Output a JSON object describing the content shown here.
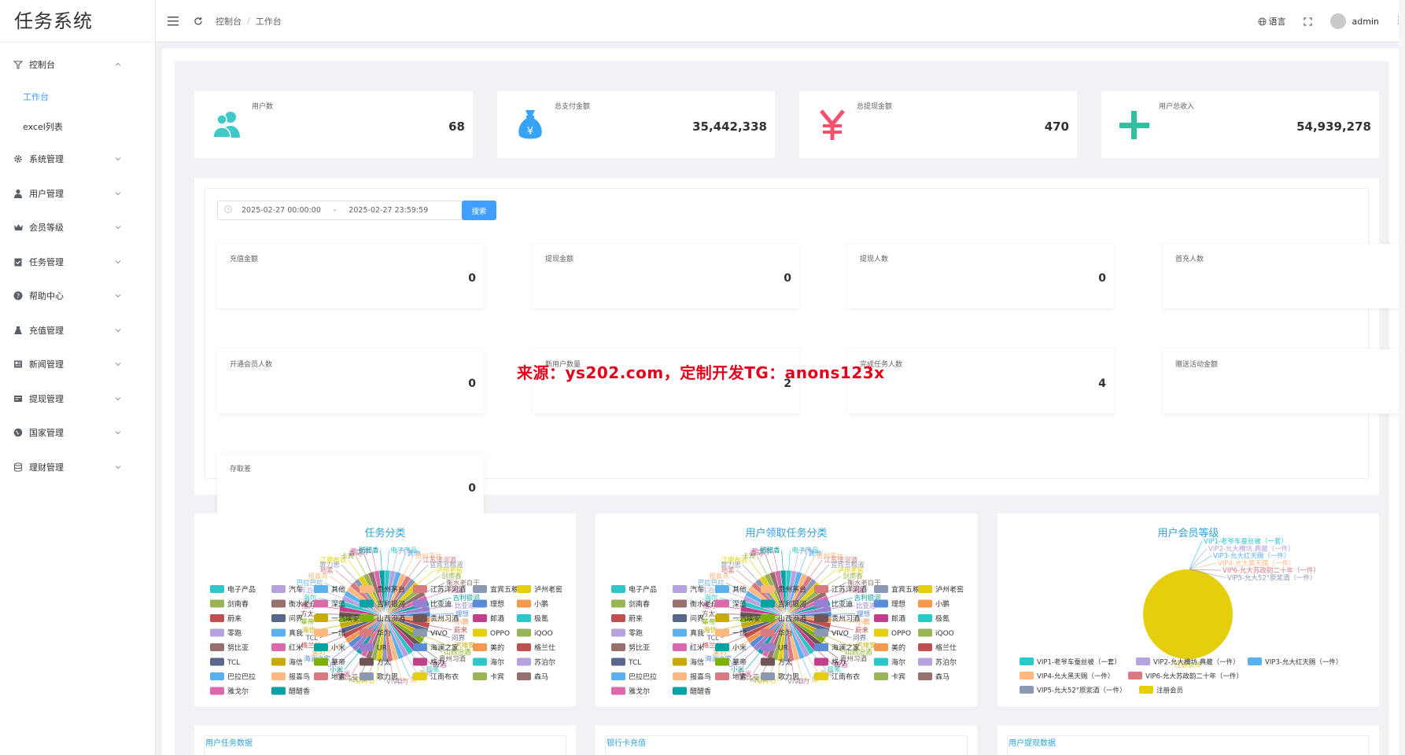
{
  "app": {
    "title": "任务系统"
  },
  "sidebar": {
    "items": [
      {
        "label": "控制台",
        "icon": "dashboard-icon",
        "expanded": true,
        "children": [
          {
            "label": "工作台",
            "active": true
          },
          {
            "label": "excel列表",
            "active": false
          }
        ]
      },
      {
        "label": "系统管理",
        "icon": "gear-icon"
      },
      {
        "label": "用户管理",
        "icon": "user-icon"
      },
      {
        "label": "会员等级",
        "icon": "crown-icon"
      },
      {
        "label": "任务管理",
        "icon": "clipboard-icon"
      },
      {
        "label": "帮助中心",
        "icon": "help-icon"
      },
      {
        "label": "充值管理",
        "icon": "flask-icon"
      },
      {
        "label": "新闻管理",
        "icon": "news-icon"
      },
      {
        "label": "提现管理",
        "icon": "withdraw-icon"
      },
      {
        "label": "国家管理",
        "icon": "globe-icon"
      },
      {
        "label": "理财管理",
        "icon": "database-icon"
      }
    ]
  },
  "header": {
    "breadcrumb": [
      "控制台",
      "工作台"
    ],
    "language_label": "语言",
    "user_name": "admin"
  },
  "stats": [
    {
      "label": "用户数",
      "value": "68",
      "icon": "users-icon",
      "color": "#40c9c6"
    },
    {
      "label": "总支付金额",
      "value": "35,442,338",
      "icon": "money-bag-icon",
      "color": "#36a3f7"
    },
    {
      "label": "总提现金额",
      "value": "470",
      "icon": "yen-icon",
      "color": "#f4516c"
    },
    {
      "label": "用户总收入",
      "value": "54,939,278",
      "icon": "plus-icon",
      "color": "#34bfa3"
    }
  ],
  "filter": {
    "start": "2025-02-27 00:00:00",
    "separator": "-",
    "end": "2025-02-27 23:59:59",
    "search_label": "搜索"
  },
  "metrics": [
    {
      "label": "充值金额",
      "value": "0"
    },
    {
      "label": "提现金额",
      "value": "0"
    },
    {
      "label": "提现人数",
      "value": "0"
    },
    {
      "label": "首充人数",
      "value": "0"
    },
    {
      "label": "开通会员人数",
      "value": "0"
    },
    {
      "label": "新用户数量",
      "value": "2"
    },
    {
      "label": "完成任务人数",
      "value": "4"
    },
    {
      "label": "赠送活动金额",
      "value": "0"
    },
    {
      "label": "存取差",
      "value": "0"
    }
  ],
  "watermark": "来源：ys202.com，定制开发TG：anons123x",
  "colors": {
    "primary": "#409eff",
    "title": "#2ea2d6",
    "palette": [
      "#2ec7c9",
      "#b6a2de",
      "#5ab1ef",
      "#ffb980",
      "#d87a80",
      "#8d98b3",
      "#e5cf0d",
      "#97b552",
      "#95706d",
      "#dc69aa",
      "#07a2a4",
      "#9a7fd1",
      "#588dd5",
      "#f5994e",
      "#c05050",
      "#59678c",
      "#c9ab00",
      "#7eb00a",
      "#6f5553",
      "#c14089"
    ]
  },
  "chart_data": [
    {
      "type": "pie",
      "title": "任务分类",
      "categories": [
        "电子产品",
        "汽车",
        "其他",
        "贵州茅台",
        "江苏洋河酒",
        "宜宾五粮液",
        "泸州老窖",
        "剑南春",
        "衡水老白干",
        "深蓝",
        "吉利银河",
        "比亚迪",
        "理想",
        "小鹏",
        "蔚来",
        "问界",
        "一汽埃安",
        "山西汾酒",
        "贵州习酒",
        "郎酒",
        "极氪",
        "零跑",
        "真我",
        "一加",
        "华为",
        "VIVO",
        "OPPO",
        "iQOO",
        "努比亚",
        "红米",
        "小米",
        "UR",
        "海澜之家",
        "美的",
        "格兰仕",
        "TCL",
        "海信",
        "華帝",
        "方太",
        "格力",
        "海尔",
        "苏泊尔",
        "巴拉巴拉",
        "报喜鸟",
        "地素",
        "歌力思",
        "江南布衣",
        "卡宾",
        "森马",
        "雅戈尔",
        "醋醋香"
      ]
    },
    {
      "type": "pie",
      "title": "用户领取任务分类",
      "categories": [
        "电子产品",
        "汽车",
        "其他",
        "贵州茅台",
        "江苏洋河酒",
        "宜宾五粮液",
        "泸州老窖",
        "剑南春",
        "衡水老白干",
        "深蓝",
        "吉利银河",
        "比亚迪",
        "理想",
        "小鹏",
        "蔚来",
        "问界",
        "一汽埃安",
        "山西汾酒",
        "贵州习酒",
        "郎酒",
        "极氪",
        "零跑",
        "真我",
        "一加",
        "华为",
        "VIVO",
        "OPPO",
        "iQOO",
        "努比亚",
        "红米",
        "小米",
        "UR",
        "海澜之家",
        "美的",
        "格兰仕",
        "TCL",
        "海信",
        "華帝",
        "方太",
        "格力",
        "海尔",
        "苏泊尔",
        "巴拉巴拉",
        "报喜鸟",
        "地素",
        "歌力思",
        "江南布衣",
        "卡宾",
        "森马",
        "雅戈尔",
        "醋醋香"
      ]
    },
    {
      "type": "pie",
      "title": "用户会员等级",
      "categories": [
        "VIP1-老爷车蚕丝被（一套）",
        "VIP2-允大槽坊.典藏（一件）",
        "VIP3-允大红天赐（一件）",
        "VIP4-允大黑天赐（一件）",
        "VIP6-允大苏政韵二十年（一件）",
        "VIP5-允大52°原浆酒（一件）",
        "注册会员"
      ],
      "values": [
        0,
        0,
        0,
        0,
        0,
        0,
        1
      ]
    }
  ],
  "bottom_cards": [
    "用户任务数据",
    "银行卡充值",
    "用户提现数据"
  ]
}
